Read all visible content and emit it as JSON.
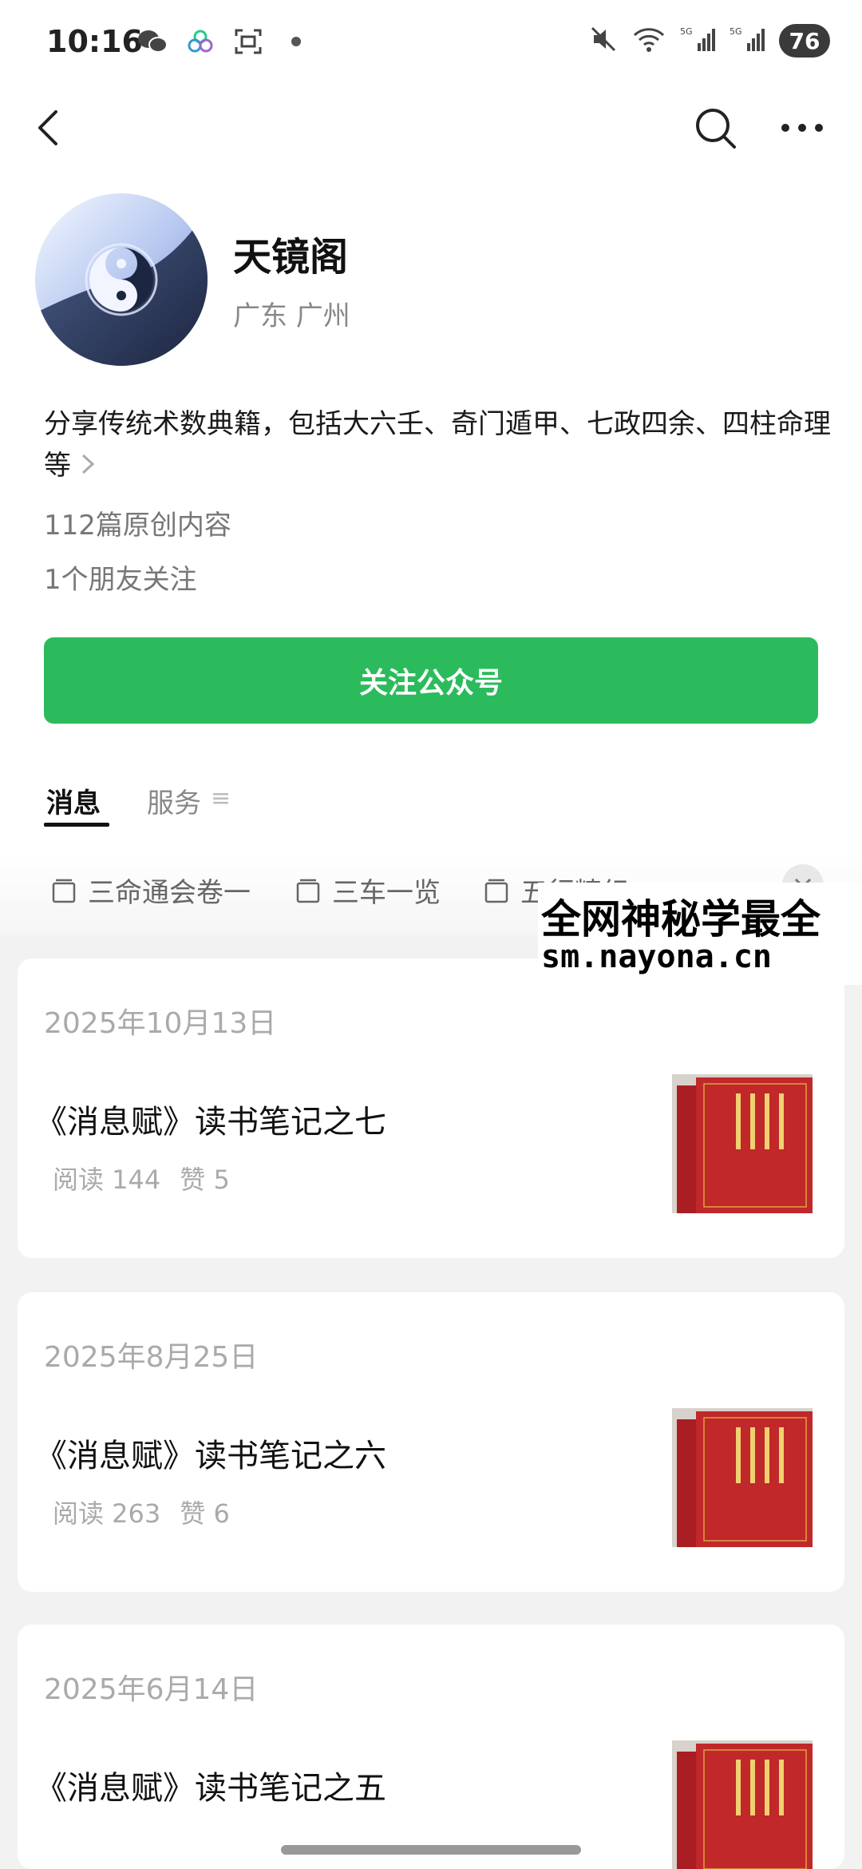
{
  "status_bar": {
    "time": "10:16",
    "battery": "76"
  },
  "account": {
    "name": "天镜阁",
    "location": "广东 广州",
    "bio": "分享传统术数典籍，包括大六壬、奇门遁甲、七政四余、四柱命理等",
    "original_count": "112篇原创内容",
    "friends_following": "1个朋友关注",
    "follow_button": "关注公众号"
  },
  "tabs": [
    {
      "label": "消息",
      "active": true
    },
    {
      "label": "服务",
      "active": false
    }
  ],
  "collections": [
    "三命通会卷一",
    "三车一览",
    "五行精纪"
  ],
  "watermark": {
    "line1": "全网神秘学最全",
    "line2": "sm.nayona.cn"
  },
  "articles": [
    {
      "date": "2025年10月13日",
      "title": "《消息赋》读书笔记之七",
      "reads": "阅读 144",
      "likes": "赞 5"
    },
    {
      "date": "2025年8月25日",
      "title": "《消息赋》读书笔记之六",
      "reads": "阅读 263",
      "likes": "赞 6"
    },
    {
      "date": "2025年6月14日",
      "title": "《消息赋》读书笔记之五",
      "reads": "",
      "likes": ""
    }
  ],
  "colors": {
    "accent_green": "#2bbb5c",
    "book_red": "#c0282a"
  },
  "icons": [
    "wechat-icon",
    "link-icon",
    "scan-icon",
    "mute-icon",
    "wifi-icon",
    "signal-5g-icon",
    "back-icon",
    "search-icon",
    "more-icon",
    "folder-icon",
    "chevron-right-icon",
    "chevron-down-icon"
  ]
}
